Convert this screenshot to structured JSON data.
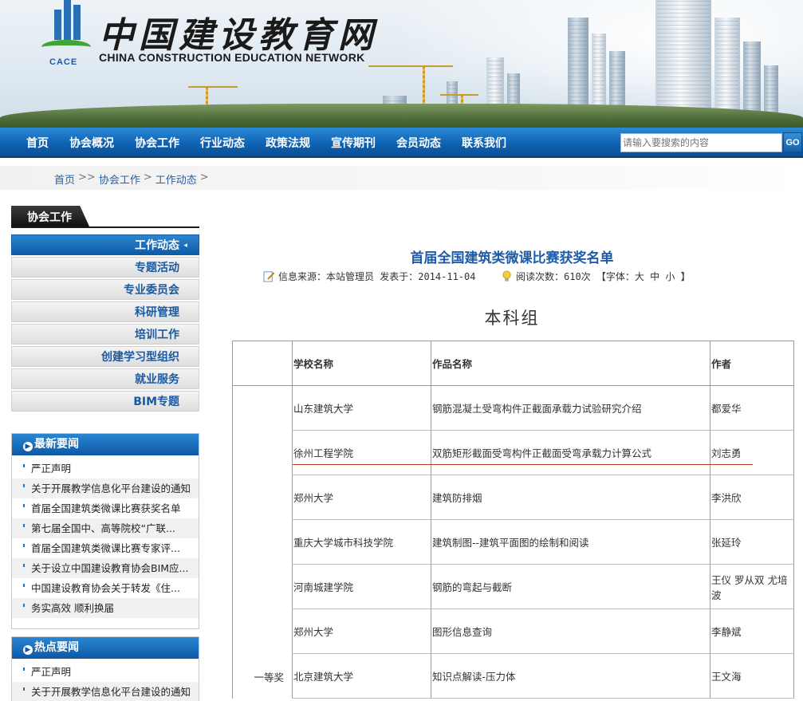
{
  "site": {
    "title_cn": "中国建设教育网",
    "title_en": "CHINA CONSTRUCTION EDUCATION NETWORK",
    "logo_text": "CACE"
  },
  "nav": {
    "items": [
      "首页",
      "协会概况",
      "协会工作",
      "行业动态",
      "政策法规",
      "宣传期刊",
      "会员动态",
      "联系我们"
    ],
    "search_placeholder": "请输入要搜索的内容",
    "search_button": "GO"
  },
  "breadcrumb": [
    "首页",
    "协会工作",
    "工作动态"
  ],
  "sidebar": {
    "heading": "协会工作",
    "menu": [
      "工作动态",
      "专题活动",
      "专业委员会",
      "科研管理",
      "培训工作",
      "创建学习型组织",
      "就业服务",
      "BIM专题"
    ],
    "latest": {
      "heading": "最新要闻",
      "items": [
        "严正声明",
        "关于开展教学信息化平台建设的通知",
        "首届全国建筑类微课比赛获奖名单",
        "第七届全国中、高等院校“广联...",
        "首届全国建筑类微课比赛专家评...",
        "关于设立中国建设教育协会BIM应...",
        "中国建设教育协会关于转发《住...",
        "务实高效 顺利换届"
      ]
    },
    "hot": {
      "heading": "热点要闻",
      "items": [
        "严正声明",
        "关于开展教学信息化平台建设的通知"
      ]
    }
  },
  "article": {
    "title": "首届全国建筑类微课比赛获奖名单",
    "source": "信息来源：本站管理员  发表于：2014-11-04",
    "reads": "阅读次数：610次  【字体：大 中 小 】",
    "section": "本科组"
  },
  "table": {
    "headers": [
      "",
      "学校名称",
      "作品名称",
      "作者"
    ],
    "award": "一等奖",
    "rows": [
      [
        "山东建筑大学",
        "钢筋混凝土受弯构件正截面承载力试验研究介绍",
        "都爱华"
      ],
      [
        "徐州工程学院",
        "双筋矩形截面受弯构件正截面受弯承载力计算公式",
        "刘志勇"
      ],
      [
        "郑州大学",
        "建筑防排烟",
        "李洪欣"
      ],
      [
        "重庆大学城市科技学院",
        "建筑制图--建筑平面图的绘制和阅读",
        "张延玲"
      ],
      [
        "河南城建学院",
        "钢筋的弯起与截断",
        "王仪 罗从双 尤培波"
      ],
      [
        "郑州大学",
        "图形信息查询",
        "李静斌"
      ],
      [
        "北京建筑大学",
        "知识点解读-压力体",
        "王文海"
      ]
    ]
  },
  "colors": {
    "nav_blue": "#0f63b3",
    "title_blue": "#1e5ca8",
    "accent_red": "#c0392b"
  }
}
